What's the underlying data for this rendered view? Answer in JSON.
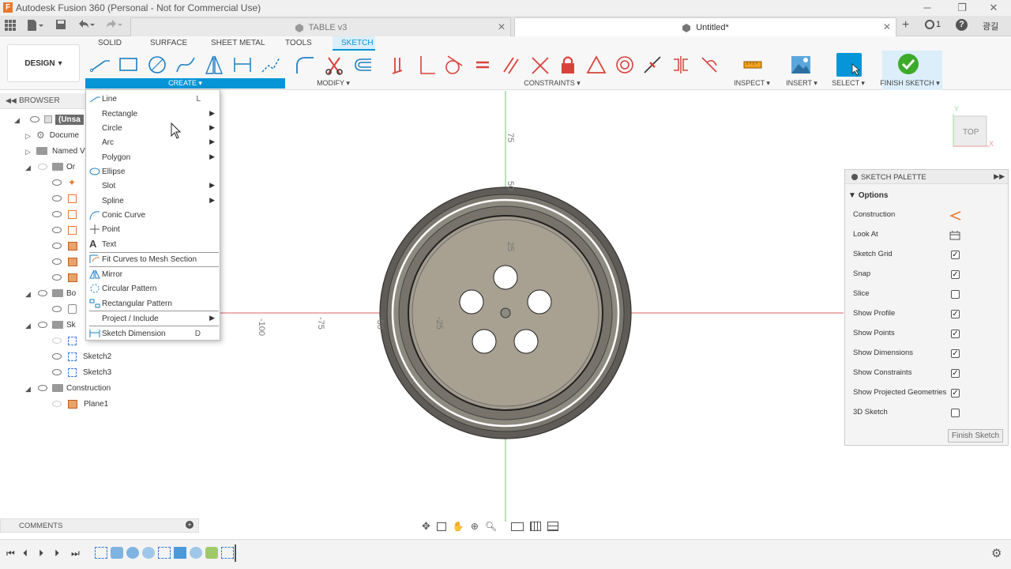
{
  "window": {
    "title": "Autodesk Fusion 360 (Personal - Not for Commercial Use)",
    "minimize": "─",
    "restore": "❐",
    "close": "✕"
  },
  "tabs": [
    {
      "label": "TABLE v3"
    },
    {
      "label": "Untitled*"
    }
  ],
  "tabbar_right": {
    "jobs_count": "1",
    "help": "?",
    "user": "광길"
  },
  "ribbon": {
    "tabs": [
      "SOLID",
      "SURFACE",
      "SHEET METAL",
      "TOOLS",
      "SKETCH"
    ],
    "active_tab": "SKETCH",
    "workspace": "DESIGN",
    "groups": {
      "create": "CREATE ▾",
      "modify": "MODIFY ▾",
      "constraints": "CONSTRAINTS ▾",
      "inspect": "INSPECT ▾",
      "insert": "INSERT ▾",
      "select": "SELECT ▾",
      "finish": "FINISH SKETCH ▾"
    }
  },
  "browser": {
    "title": "BROWSER",
    "items": [
      {
        "label": "(Unsa"
      },
      {
        "label": "Docume"
      },
      {
        "label": "Named V"
      },
      {
        "label": "Or"
      },
      {
        "label": "Bo"
      },
      {
        "label": "Sk"
      },
      {
        "label": "Sketch2"
      },
      {
        "label": "Sketch3"
      },
      {
        "label": "Construction"
      },
      {
        "label": "Plane1"
      }
    ]
  },
  "create_menu": {
    "items": [
      {
        "label": "Line",
        "key": "L",
        "submenu": false
      },
      {
        "label": "Rectangle",
        "submenu": true
      },
      {
        "label": "Circle",
        "submenu": true
      },
      {
        "label": "Arc",
        "submenu": true
      },
      {
        "label": "Polygon",
        "submenu": true
      },
      {
        "label": "Ellipse",
        "submenu": false
      },
      {
        "label": "Slot",
        "submenu": true
      },
      {
        "label": "Spline",
        "submenu": true
      },
      {
        "label": "Conic Curve",
        "submenu": false
      },
      {
        "label": "Point",
        "submenu": false
      },
      {
        "label": "Text",
        "submenu": false
      },
      {
        "label": "Fit Curves to Mesh Section",
        "submenu": false
      },
      {
        "label": "Mirror",
        "submenu": false
      },
      {
        "label": "Circular Pattern",
        "submenu": false
      },
      {
        "label": "Rectangular Pattern",
        "submenu": false
      },
      {
        "label": "Project / Include",
        "submenu": true
      },
      {
        "label": "Sketch Dimension",
        "key": "D",
        "submenu": false
      }
    ]
  },
  "canvas": {
    "axis_labels": {
      "v75": "75",
      "v50": "50",
      "v25": "25",
      "hm100": "-100",
      "hm75": "-75",
      "hm50": "-50",
      "hm25": "-25"
    },
    "viewcube": "TOP",
    "viewcube_axes": {
      "y": "Y",
      "x": "X"
    }
  },
  "palette": {
    "title": "SKETCH PALETTE",
    "section": "Options",
    "rows": [
      {
        "label": "Construction",
        "type": "icon",
        "icon": "construction-icon"
      },
      {
        "label": "Look At",
        "type": "icon",
        "icon": "look-at-icon"
      },
      {
        "label": "Sketch Grid",
        "type": "check",
        "checked": true
      },
      {
        "label": "Snap",
        "type": "check",
        "checked": true
      },
      {
        "label": "Slice",
        "type": "check",
        "checked": false
      },
      {
        "label": "Show Profile",
        "type": "check",
        "checked": true
      },
      {
        "label": "Show Points",
        "type": "check",
        "checked": true
      },
      {
        "label": "Show Dimensions",
        "type": "check",
        "checked": true
      },
      {
        "label": "Show Constraints",
        "type": "check",
        "checked": true
      },
      {
        "label": "Show Projected Geometries",
        "type": "check",
        "checked": true
      },
      {
        "label": "3D Sketch",
        "type": "check",
        "checked": false
      }
    ],
    "finish_button": "Finish Sketch"
  },
  "comments": {
    "label": "COMMENTS"
  },
  "colors": {
    "accent": "#0696d7",
    "sketch_red": "#d9423b",
    "finish_green": "#3dab2a",
    "axis_green": "#7fd07f",
    "axis_red": "#e06060"
  }
}
